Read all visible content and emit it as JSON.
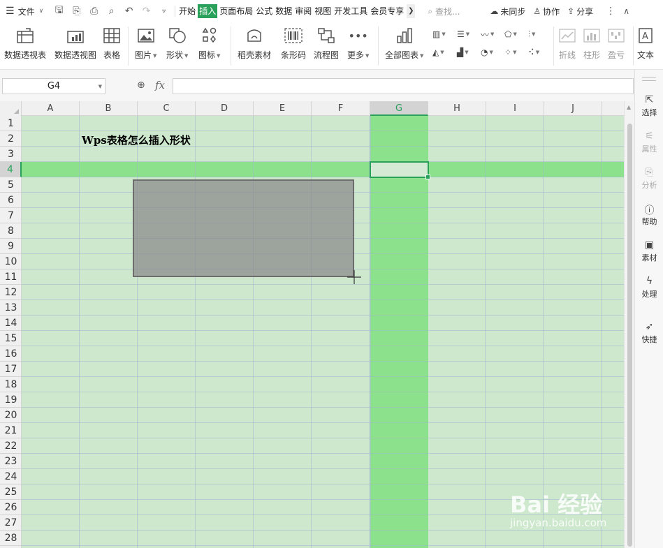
{
  "menubar": {
    "file_label": "文件",
    "tabs": [
      "开始",
      "插入",
      "页面布局",
      "公式",
      "数据",
      "审阅",
      "视图",
      "开发工具",
      "会员专享"
    ],
    "active_tab": "插入",
    "search_placeholder": "查找...",
    "unsynced_label": "未同步",
    "collaborate_label": "协作",
    "share_label": "分享"
  },
  "ribbon": {
    "pivot_table": "数据透视表",
    "pivot_chart": "数据透视图",
    "table": "表格",
    "picture": "图片",
    "shape": "形状",
    "icon": "图标",
    "docer_material": "稻壳素材",
    "barcode": "条形码",
    "flowchart": "流程图",
    "more": "更多",
    "all_charts": "全部图表",
    "sparkline_line": "折线",
    "sparkline_column": "柱形",
    "sparkline_winloss": "盈亏",
    "text": "文本"
  },
  "formula_bar": {
    "name_box": "G4",
    "fx_label": "fx",
    "formula": ""
  },
  "sheet": {
    "columns": [
      "A",
      "B",
      "C",
      "D",
      "E",
      "F",
      "G",
      "H",
      "I",
      "J"
    ],
    "rows": [
      "1",
      "2",
      "3",
      "4",
      "5",
      "6",
      "7",
      "8",
      "9",
      "10",
      "11",
      "12",
      "13",
      "14",
      "15",
      "16",
      "17",
      "18",
      "19",
      "20",
      "21",
      "22",
      "23",
      "24",
      "25",
      "26",
      "27",
      "28"
    ],
    "selected_column": "G",
    "selected_row": "4",
    "title_text": "Wps表格怎么插入形状"
  },
  "side_panel": {
    "select": "选择",
    "properties": "属性",
    "analysis": "分析",
    "help": "帮助",
    "material": "素材",
    "process": "处理",
    "quick": "快捷"
  },
  "watermark": {
    "brand": "Bai 经验",
    "url": "jingyan.baidu.com"
  },
  "colors": {
    "accent": "#2aa15a",
    "cell_bg": "#cde8cd",
    "highlight": "#8ce28c",
    "shape_fill": "#8c8c8c"
  }
}
